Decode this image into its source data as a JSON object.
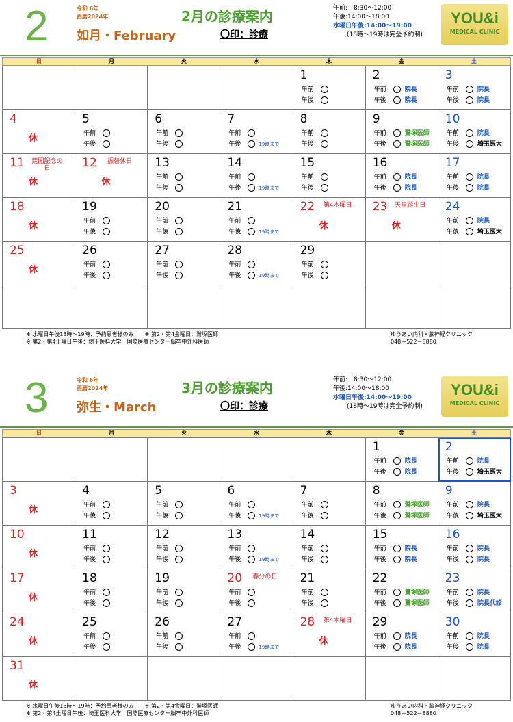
{
  "common": {
    "maru": "〇印：診療",
    "dows": [
      "日",
      "月",
      "火",
      "水",
      "木",
      "金",
      "土"
    ],
    "am": "午前",
    "pm": "午後",
    "holiday_mark": "休",
    "hours": [
      "午前:　8:30～12:00",
      "午後:14:00～18:00",
      "水曜日午後:14:00～19:00",
      "(18時～19時は完全予約制)"
    ],
    "logo_top": "YOU&i",
    "logo_bottom": "MEDICAL CLINIC",
    "foot_lines": [
      "※ 水曜日午後18時～19時：予約患者様のみ　　※ 第2・第4金曜日：鷲塚医師",
      "※ 第2・第4土曜日午後：埼玉医科大学　国際医療センター脳卒中外科医師"
    ],
    "clinic_name": "ゆうあい内科・脳神経クリニック",
    "clinic_phone": "048－522－8880"
  },
  "months": [
    {
      "num": "2",
      "era1": "令和 6年",
      "era2": "西暦2024年",
      "name": "如月・February",
      "title": "2月の診療案内",
      "cells": [
        {
          "d": "",
          "t": "empty"
        },
        {
          "d": "",
          "t": "empty"
        },
        {
          "d": "",
          "t": "empty"
        },
        {
          "d": "",
          "t": "empty"
        },
        {
          "d": "1",
          "t": "open"
        },
        {
          "d": "2",
          "t": "open",
          "am": "院長",
          "amc": "dir",
          "pm": "院長",
          "pmc": "dir"
        },
        {
          "d": "3",
          "t": "open",
          "w": "sat",
          "am": "院長",
          "amc": "dir",
          "pm": "院長",
          "pmc": "dir"
        },
        {
          "d": "4",
          "t": "closed",
          "w": "sun"
        },
        {
          "d": "5",
          "t": "open"
        },
        {
          "d": "6",
          "t": "open"
        },
        {
          "d": "7",
          "t": "open",
          "until": "19時まで"
        },
        {
          "d": "8",
          "t": "open"
        },
        {
          "d": "9",
          "t": "open",
          "am": "鷲塚医師",
          "amc": "wash",
          "pm": "鷲塚医師",
          "pmc": "wash"
        },
        {
          "d": "10",
          "t": "open",
          "w": "sat",
          "am": "院長",
          "amc": "dir",
          "pm": "埼玉医大",
          "pmc": "sai"
        },
        {
          "d": "11",
          "t": "closed",
          "w": "sun",
          "hn": "建国記念の日"
        },
        {
          "d": "12",
          "t": "closed",
          "w": "hol",
          "hn": "振替休日"
        },
        {
          "d": "13",
          "t": "open"
        },
        {
          "d": "14",
          "t": "open",
          "until": "19時まで"
        },
        {
          "d": "15",
          "t": "open"
        },
        {
          "d": "16",
          "t": "open",
          "am": "院長",
          "amc": "dir",
          "pm": "院長",
          "pmc": "dir"
        },
        {
          "d": "17",
          "t": "open",
          "w": "sat",
          "am": "院長",
          "amc": "dir",
          "pm": "院長",
          "pmc": "dir"
        },
        {
          "d": "18",
          "t": "closed",
          "w": "sun"
        },
        {
          "d": "19",
          "t": "open"
        },
        {
          "d": "20",
          "t": "open"
        },
        {
          "d": "21",
          "t": "open",
          "until": "19時まで"
        },
        {
          "d": "22",
          "t": "closed",
          "w": "hol",
          "hn": "第4木曜日"
        },
        {
          "d": "23",
          "t": "closed",
          "w": "hol",
          "hn": "天皇誕生日"
        },
        {
          "d": "24",
          "t": "open",
          "w": "sat",
          "am": "院長",
          "amc": "dir",
          "pm": "埼玉医大",
          "pmc": "sai"
        },
        {
          "d": "25",
          "t": "closed",
          "w": "sun"
        },
        {
          "d": "26",
          "t": "open"
        },
        {
          "d": "27",
          "t": "open"
        },
        {
          "d": "28",
          "t": "open",
          "until": "19時まで"
        },
        {
          "d": "29",
          "t": "open"
        },
        {
          "d": "",
          "t": "empty"
        },
        {
          "d": "",
          "t": "empty"
        },
        {
          "d": "",
          "t": "empty"
        },
        {
          "d": "",
          "t": "empty"
        },
        {
          "d": "",
          "t": "empty"
        },
        {
          "d": "",
          "t": "empty"
        },
        {
          "d": "",
          "t": "empty"
        },
        {
          "d": "",
          "t": "empty"
        },
        {
          "d": "",
          "t": "empty"
        }
      ]
    },
    {
      "num": "3",
      "era1": "令和 6年",
      "era2": "西暦2024年",
      "name": "弥生・March",
      "title": "3月の診療案内",
      "cells": [
        {
          "d": "",
          "t": "empty"
        },
        {
          "d": "",
          "t": "empty"
        },
        {
          "d": "",
          "t": "empty"
        },
        {
          "d": "",
          "t": "empty"
        },
        {
          "d": "",
          "t": "empty"
        },
        {
          "d": "1",
          "t": "open",
          "am": "院長",
          "amc": "dir",
          "pm": "院長",
          "pmc": "dir"
        },
        {
          "d": "2",
          "t": "open",
          "w": "sat",
          "sel": true,
          "am": "院長",
          "amc": "dir",
          "pm": "埼玉医大",
          "pmc": "sai"
        },
        {
          "d": "3",
          "t": "closed",
          "w": "sun"
        },
        {
          "d": "4",
          "t": "open"
        },
        {
          "d": "5",
          "t": "open"
        },
        {
          "d": "6",
          "t": "open",
          "until": "19時まで"
        },
        {
          "d": "7",
          "t": "open"
        },
        {
          "d": "8",
          "t": "open",
          "am": "鷲塚医師",
          "amc": "wash",
          "pm": "鷲塚医師",
          "pmc": "wash"
        },
        {
          "d": "9",
          "t": "open",
          "w": "sat",
          "am": "院長",
          "amc": "dir",
          "pm": "埼玉医大",
          "pmc": "sai"
        },
        {
          "d": "10",
          "t": "closed",
          "w": "sun"
        },
        {
          "d": "11",
          "t": "open"
        },
        {
          "d": "12",
          "t": "open"
        },
        {
          "d": "13",
          "t": "open",
          "until": "19時まで"
        },
        {
          "d": "14",
          "t": "open"
        },
        {
          "d": "15",
          "t": "open",
          "am": "院長",
          "amc": "dir",
          "pm": "院長",
          "pmc": "dir"
        },
        {
          "d": "16",
          "t": "open",
          "w": "sat",
          "am": "院長",
          "amc": "dir",
          "pm": "院長",
          "pmc": "dir"
        },
        {
          "d": "17",
          "t": "closed",
          "w": "sun"
        },
        {
          "d": "18",
          "t": "open"
        },
        {
          "d": "19",
          "t": "open"
        },
        {
          "d": "20",
          "t": "holopen",
          "hn": "春分の日"
        },
        {
          "d": "21",
          "t": "open"
        },
        {
          "d": "22",
          "t": "open",
          "am": "鷲塚医師",
          "amc": "wash",
          "pm": "鷲塚医師",
          "pmc": "wash"
        },
        {
          "d": "23",
          "t": "open",
          "w": "sat",
          "am": "院長",
          "amc": "dir",
          "pm": "院長代診",
          "pmc": "dir"
        },
        {
          "d": "24",
          "t": "closed",
          "w": "sun"
        },
        {
          "d": "25",
          "t": "open"
        },
        {
          "d": "26",
          "t": "open"
        },
        {
          "d": "27",
          "t": "open",
          "until": "19時まで"
        },
        {
          "d": "28",
          "t": "closed",
          "w": "hol",
          "hn": "第4木曜日"
        },
        {
          "d": "29",
          "t": "open",
          "am": "院長",
          "amc": "dir",
          "pm": "院長",
          "pmc": "dir"
        },
        {
          "d": "30",
          "t": "open",
          "w": "sat",
          "am": "院長",
          "amc": "dir",
          "pm": "院長",
          "pmc": "dir"
        },
        {
          "d": "31",
          "t": "closed",
          "w": "sun"
        },
        {
          "d": "",
          "t": "empty"
        },
        {
          "d": "",
          "t": "empty"
        },
        {
          "d": "",
          "t": "empty"
        },
        {
          "d": "",
          "t": "empty"
        },
        {
          "d": "",
          "t": "empty"
        },
        {
          "d": "",
          "t": "empty"
        }
      ]
    }
  ]
}
